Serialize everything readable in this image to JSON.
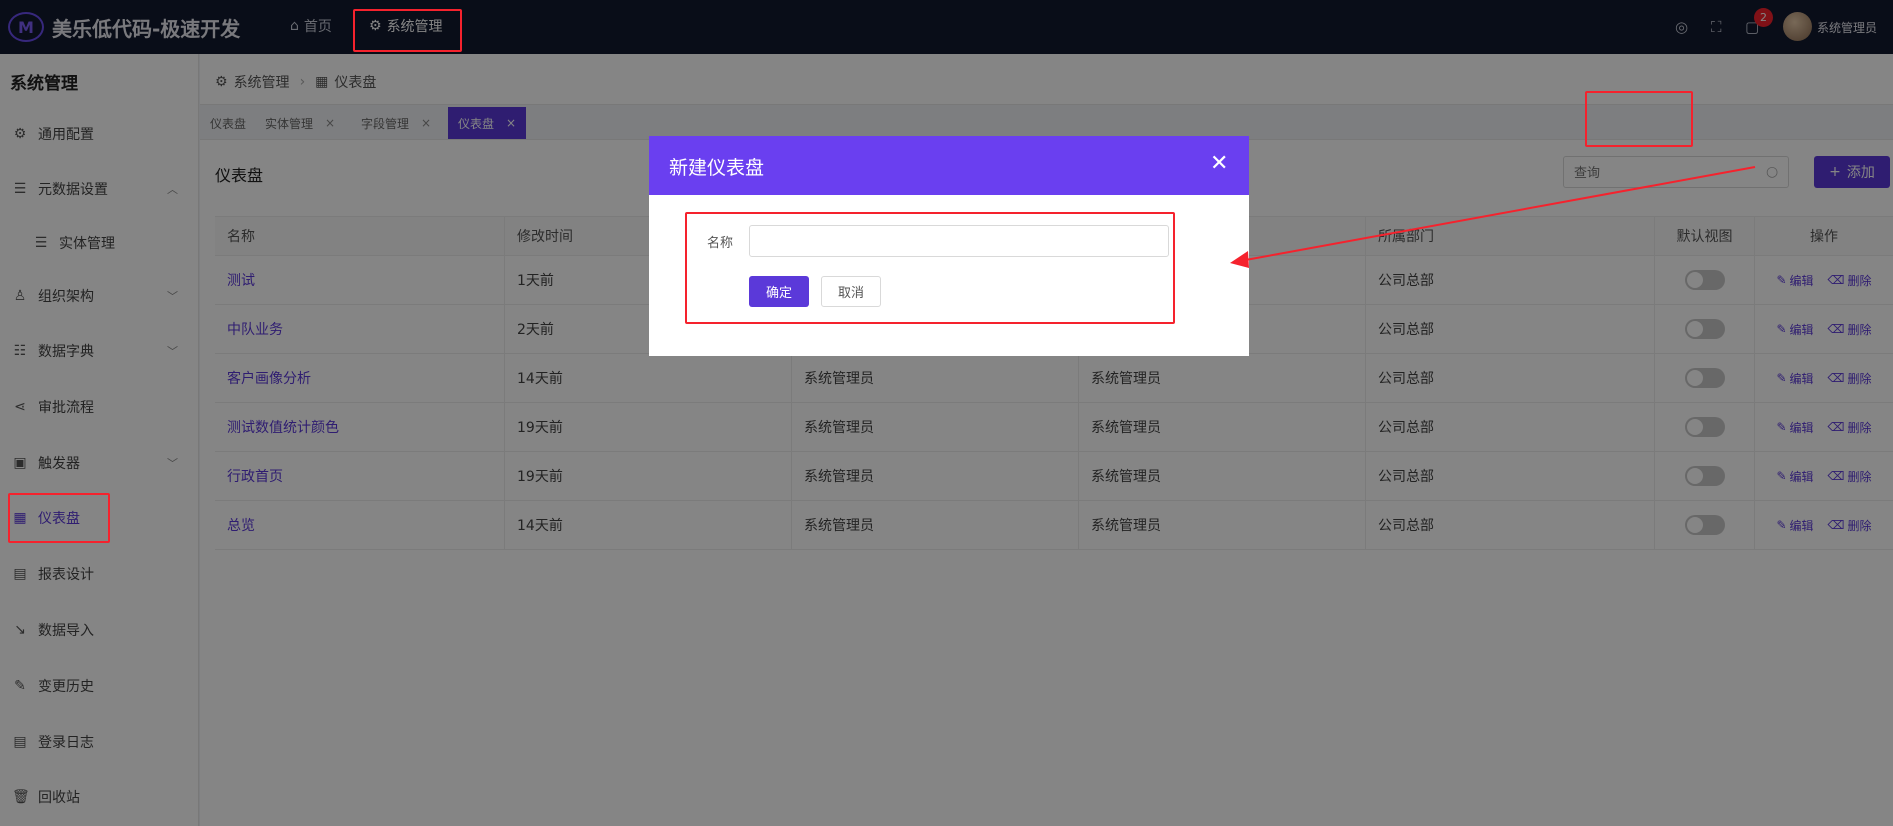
{
  "app": {
    "logo_mark": "M",
    "title": "美乐低代码-极速开发"
  },
  "topnav": {
    "home": "首页",
    "system": "系统管理",
    "badge_count": "2",
    "username": "系统管理员"
  },
  "sidebar": {
    "title": "系统管理",
    "items": [
      {
        "label": "通用配置",
        "icon": "gear-icon"
      },
      {
        "label": "元数据设置",
        "icon": "database-icon",
        "expanded": true
      },
      {
        "label": "实体管理",
        "icon": "database-icon"
      },
      {
        "label": "组织架构",
        "icon": "user-icon"
      },
      {
        "label": "数据字典",
        "icon": "sliders-icon"
      },
      {
        "label": "审批流程",
        "icon": "share-icon"
      },
      {
        "label": "触发器",
        "icon": "chip-icon"
      },
      {
        "label": "仪表盘",
        "icon": "grid-icon",
        "active": true
      },
      {
        "label": "报表设计",
        "icon": "report-icon"
      },
      {
        "label": "数据导入",
        "icon": "import-icon"
      },
      {
        "label": "变更历史",
        "icon": "edit-icon"
      },
      {
        "label": "登录日志",
        "icon": "log-icon"
      },
      {
        "label": "回收站",
        "icon": "trash-icon"
      }
    ]
  },
  "breadcrumb": {
    "root": "系统管理",
    "current": "仪表盘"
  },
  "tabs": [
    {
      "label": "仪表盘"
    },
    {
      "label": "实体管理"
    },
    {
      "label": "字段管理"
    },
    {
      "label": "仪表盘",
      "active": true
    }
  ],
  "page": {
    "title": "仪表盘",
    "search_placeholder": "查询",
    "add_label": "添加"
  },
  "table": {
    "headers": {
      "name": "名称",
      "modified": "修改时间",
      "dept": "所属部门",
      "default_view": "默认视图",
      "ops": "操作"
    },
    "edit_label": "编辑",
    "delete_label": "删除",
    "rows": [
      {
        "name": "测试",
        "time": "1天前",
        "c3": "",
        "c4": "",
        "dept": "公司总部"
      },
      {
        "name": "中队业务",
        "time": "2天前",
        "c3": "",
        "c4": "",
        "dept": "公司总部"
      },
      {
        "name": "客户画像分析",
        "time": "14天前",
        "c3": "系统管理员",
        "c4": "系统管理员",
        "dept": "公司总部"
      },
      {
        "name": "测试数值统计颜色",
        "time": "19天前",
        "c3": "系统管理员",
        "c4": "系统管理员",
        "dept": "公司总部"
      },
      {
        "name": "行政首页",
        "time": "19天前",
        "c3": "系统管理员",
        "c4": "系统管理员",
        "dept": "公司总部"
      },
      {
        "name": "总览",
        "time": "14天前",
        "c3": "系统管理员",
        "c4": "系统管理员",
        "dept": "公司总部"
      }
    ]
  },
  "modal": {
    "title": "新建仪表盘",
    "name_label": "名称",
    "name_value": "",
    "ok_label": "确定",
    "cancel_label": "取消"
  },
  "colors": {
    "brand": "#5b39d9",
    "modal_header": "#6a3ff0",
    "topbar": "#131a2e",
    "highlight": "#f5222d"
  }
}
